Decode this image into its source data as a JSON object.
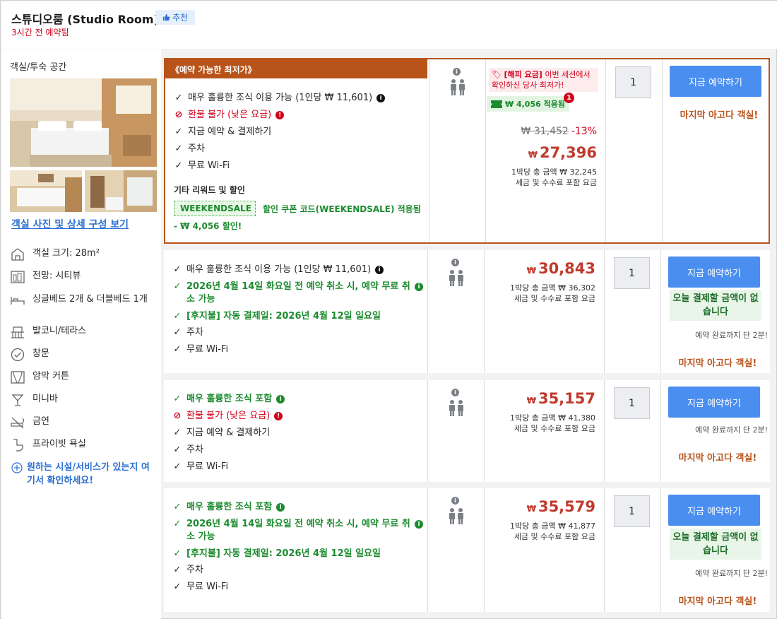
{
  "header": {
    "room_title": "스튜디오룸 (Studio Room)",
    "recommend": "추천",
    "recent": "3시간 전 예약됨"
  },
  "left": {
    "section_label": "객실/투숙 공간",
    "photo_link": "객실 사진 및 상세 구성 보기",
    "amenities": [
      {
        "icon": "room-size-icon",
        "label": "객실 크기: 28m²"
      },
      {
        "icon": "view-icon",
        "label": "전망: 시티뷰"
      },
      {
        "icon": "bed-icon",
        "label": "싱글베드 2개 & 더블베드 1개"
      },
      {
        "icon": "balcony-icon",
        "label": "발코니/테라스"
      },
      {
        "icon": "window-icon",
        "label": "창문"
      },
      {
        "icon": "curtain-icon",
        "label": "암막 커튼"
      },
      {
        "icon": "minibar-icon",
        "label": "미니바"
      },
      {
        "icon": "no-smoking-icon",
        "label": "금연"
      },
      {
        "icon": "bathroom-icon",
        "label": "프라이빗 욕실"
      }
    ],
    "more_link": "원하는 시설/서비스가 있는지 여기서 확인하세요!"
  },
  "offers": [
    {
      "tag": "《예약 가능한 최저가》",
      "features": [
        {
          "type": "check",
          "text": "매우 훌륭한 조식 이용 가능 (1인당 ₩ 11,601)",
          "info": "black"
        },
        {
          "type": "no",
          "text": "환불 불가 (낮은 요금)",
          "info": "red"
        },
        {
          "type": "check",
          "text": "지금 예약 & 결제하기"
        },
        {
          "type": "check",
          "text": "주차"
        },
        {
          "type": "check",
          "text": "무료 Wi-Fi"
        }
      ],
      "other_rewards": "기타 리워드 및 할인",
      "coupon_code": "WEEKENDSALE",
      "coupon_text": "할인 쿠폰 코드(WEEKENDSALE) 적용됨",
      "coupon_discount": "- ₩ 4,056 할인!",
      "happy_label": "[해피 요금]",
      "happy_text": "이번 세션에서 확인하신 당사 최저가!",
      "applied": "₩ 4,056 적용됨",
      "applied_count": "1",
      "original_price": "₩ 31,452",
      "discount_pct": "-13%",
      "currency": "₩",
      "price": "27,396",
      "per_night": "1박당 총 금액 ₩ 32,245",
      "tax_note": "세금 및 수수료 포함 요금",
      "qty": "1",
      "book_label": "지금 예약하기",
      "last_room": "마지막 아고다 객실!"
    },
    {
      "features": [
        {
          "type": "check",
          "text": "매우 훌륭한 조식 이용 가능 (1인당 ₩ 11,601)",
          "info": "black"
        },
        {
          "type": "green",
          "text": "2026년 4월 14일 화요일 전 예약 취소 시, 예약 무료 취소 가능",
          "info": "green"
        },
        {
          "type": "green",
          "text": "[후지불] 자동 결제일: 2026년 4월 12일 일요일"
        },
        {
          "type": "check",
          "text": "주차"
        },
        {
          "type": "check",
          "text": "무료 Wi-Fi"
        }
      ],
      "currency": "₩",
      "price": "30,843",
      "per_night": "1박당 총 금액 ₩ 36,302",
      "tax_note": "세금 및 수수료 포함 요금",
      "qty": "1",
      "book_label": "지금 예약하기",
      "pay_later": "오늘 결제할 금액이 없습니다",
      "minutes": "예약 완료까지 단 2분!",
      "last_room": "마지막 아고다 객실!"
    },
    {
      "features": [
        {
          "type": "green",
          "text": "매우 훌륭한 조식 포함",
          "info": "green"
        },
        {
          "type": "no",
          "text": "환불 불가 (낮은 요금)",
          "info": "red"
        },
        {
          "type": "check",
          "text": "지금 예약 & 결제하기"
        },
        {
          "type": "check",
          "text": "주차"
        },
        {
          "type": "check",
          "text": "무료 Wi-Fi"
        }
      ],
      "currency": "₩",
      "price": "35,157",
      "per_night": "1박당 총 금액 ₩ 41,380",
      "tax_note": "세금 및 수수료 포함 요금",
      "qty": "1",
      "book_label": "지금 예약하기",
      "minutes": "예약 완료까지 단 2분!",
      "last_room": "마지막 아고다 객실!"
    },
    {
      "features": [
        {
          "type": "green",
          "text": "매우 훌륭한 조식 포함",
          "info": "green"
        },
        {
          "type": "green",
          "text": "2026년 4월 14일 화요일 전 예약 취소 시, 예약 무료 취소 가능",
          "info": "green"
        },
        {
          "type": "green",
          "text": "[후지불] 자동 결제일: 2026년 4월 12일 일요일"
        },
        {
          "type": "check",
          "text": "주차"
        },
        {
          "type": "check",
          "text": "무료 Wi-Fi"
        }
      ],
      "currency": "₩",
      "price": "35,579",
      "per_night": "1박당 총 금액 ₩ 41,877",
      "tax_note": "세금 및 수수료 포함 요금",
      "qty": "1",
      "book_label": "지금 예약하기",
      "pay_later": "오늘 결제할 금액이 없습니다",
      "minutes": "예약 완료까지 단 2분!",
      "last_room": "마지막 아고다 객실!"
    }
  ],
  "colors": {
    "accent": "#4a8ef0",
    "deal": "#b8531a",
    "price": "#c0392b",
    "green": "#1b8b2e",
    "red": "#d0021b"
  }
}
